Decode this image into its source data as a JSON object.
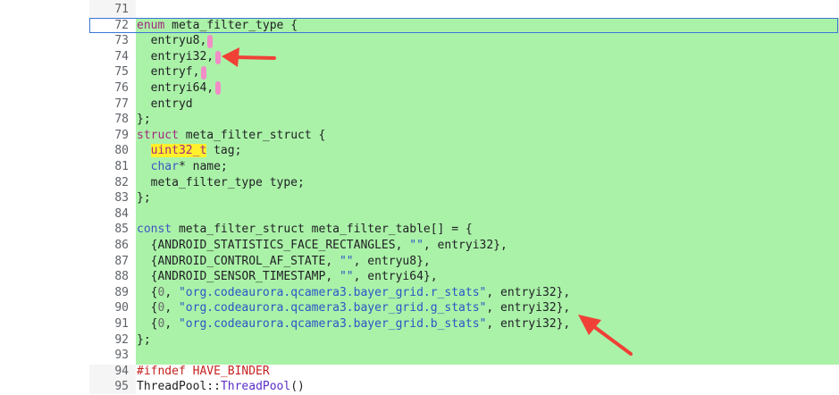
{
  "colors": {
    "highlight": "#aaf2a8",
    "cursor_frame": "#3d74d6",
    "keyword": "#a4287f",
    "string": "#2a56c6",
    "preprocessor": "#c5221f",
    "marker": "#f28cc7",
    "arrow": "#ef4136"
  },
  "lines": [
    {
      "n": "71",
      "tokens": []
    },
    {
      "n": "72",
      "tokens": [
        {
          "t": "enum",
          "c": "tok-kw"
        },
        {
          "t": " meta_filter_type {"
        }
      ]
    },
    {
      "n": "73",
      "tokens": [
        {
          "t": "  entryu8,"
        }
      ]
    },
    {
      "n": "74",
      "tokens": [
        {
          "t": "  entryi32,"
        }
      ]
    },
    {
      "n": "75",
      "tokens": [
        {
          "t": "  entryf,"
        }
      ]
    },
    {
      "n": "76",
      "tokens": [
        {
          "t": "  entryi64,"
        }
      ]
    },
    {
      "n": "77",
      "tokens": [
        {
          "t": "  entryd"
        }
      ]
    },
    {
      "n": "78",
      "tokens": [
        {
          "t": "};"
        }
      ]
    },
    {
      "n": "79",
      "tokens": [
        {
          "t": "struct",
          "c": "tok-kw"
        },
        {
          "t": " meta_filter_struct {"
        }
      ]
    },
    {
      "n": "80",
      "tokens": [
        {
          "t": "  "
        },
        {
          "t": "uint32_t",
          "c": "tok-type-hl"
        },
        {
          "t": " tag;"
        }
      ]
    },
    {
      "n": "81",
      "tokens": [
        {
          "t": "  "
        },
        {
          "t": "char",
          "c": "tok-type"
        },
        {
          "t": "* name;"
        }
      ]
    },
    {
      "n": "82",
      "tokens": [
        {
          "t": "  meta_filter_type type;"
        }
      ]
    },
    {
      "n": "83",
      "tokens": [
        {
          "t": "};"
        }
      ]
    },
    {
      "n": "84",
      "tokens": []
    },
    {
      "n": "85",
      "tokens": [
        {
          "t": "const",
          "c": "tok-type"
        },
        {
          "t": " meta_filter_struct meta_filter_table[] = {"
        }
      ]
    },
    {
      "n": "86",
      "tokens": [
        {
          "t": "  {ANDROID_STATISTICS_FACE_RECTANGLES, "
        },
        {
          "t": "\"\"",
          "c": "tok-str"
        },
        {
          "t": ", entryi32},"
        }
      ]
    },
    {
      "n": "87",
      "tokens": [
        {
          "t": "  {ANDROID_CONTROL_AF_STATE, "
        },
        {
          "t": "\"\"",
          "c": "tok-str"
        },
        {
          "t": ", entryu8},"
        }
      ]
    },
    {
      "n": "88",
      "tokens": [
        {
          "t": "  {ANDROID_SENSOR_TIMESTAMP, "
        },
        {
          "t": "\"\"",
          "c": "tok-str"
        },
        {
          "t": ", entryi64},"
        }
      ]
    },
    {
      "n": "89",
      "tokens": [
        {
          "t": "  {"
        },
        {
          "t": "0",
          "c": "tok-num"
        },
        {
          "t": ", "
        },
        {
          "t": "\"org.codeaurora.qcamera3.bayer_grid.r_stats\"",
          "c": "tok-str"
        },
        {
          "t": ", entryi32},"
        }
      ]
    },
    {
      "n": "90",
      "tokens": [
        {
          "t": "  {"
        },
        {
          "t": "0",
          "c": "tok-num"
        },
        {
          "t": ", "
        },
        {
          "t": "\"org.codeaurora.qcamera3.bayer_grid.g_stats\"",
          "c": "tok-str"
        },
        {
          "t": ", entryi32},"
        }
      ]
    },
    {
      "n": "91",
      "tokens": [
        {
          "t": "  {"
        },
        {
          "t": "0",
          "c": "tok-num"
        },
        {
          "t": ", "
        },
        {
          "t": "\"org.codeaurora.qcamera3.bayer_grid.b_stats\"",
          "c": "tok-str"
        },
        {
          "t": ", entryi32},"
        }
      ]
    },
    {
      "n": "92",
      "tokens": [
        {
          "t": "};"
        }
      ]
    },
    {
      "n": "93",
      "tokens": []
    },
    {
      "n": "94",
      "tokens": [
        {
          "t": "#ifndef HAVE_BINDER",
          "c": "tok-pp"
        }
      ]
    },
    {
      "n": "95",
      "tokens": [
        {
          "t": "ThreadPool",
          "c": "tok-ns"
        },
        {
          "t": "::"
        },
        {
          "t": "ThreadPool",
          "c": "tok-fn"
        },
        {
          "t": "()"
        }
      ]
    }
  ]
}
